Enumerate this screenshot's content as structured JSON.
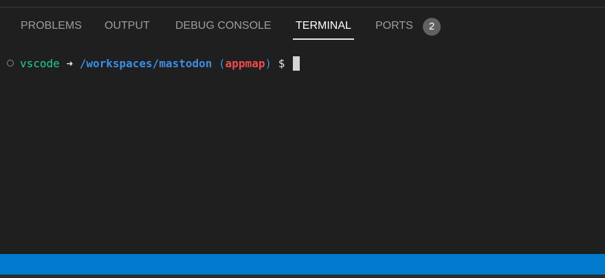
{
  "panel": {
    "tabs": [
      {
        "label": "PROBLEMS"
      },
      {
        "label": "OUTPUT"
      },
      {
        "label": "DEBUG CONSOLE"
      },
      {
        "label": "TERMINAL"
      },
      {
        "label": "PORTS"
      }
    ],
    "active_tab": "TERMINAL",
    "ports_badge": "2"
  },
  "terminal": {
    "user": "vscode",
    "arrow": "➜",
    "path": "/workspaces/mastodon",
    "branch_open": "(",
    "branch": "appmap",
    "branch_close": ")",
    "prompt": "$"
  },
  "colors": {
    "status_bar": "#007acc",
    "user": "#23d18b",
    "path": "#3b8eea",
    "branch": "#f14c4c"
  }
}
